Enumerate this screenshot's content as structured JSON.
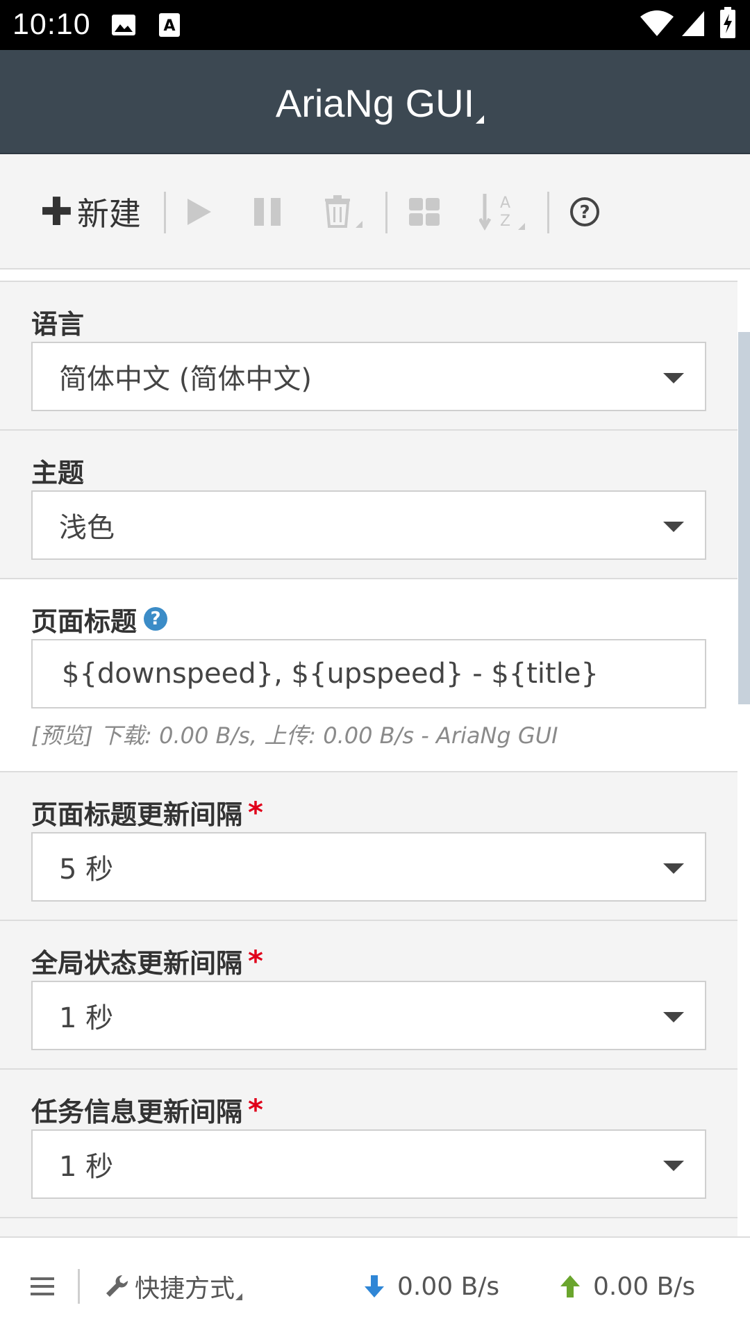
{
  "status_bar": {
    "time": "10:10"
  },
  "header": {
    "title": "AriaNg GUI"
  },
  "toolbar": {
    "new_label": "新建"
  },
  "settings": [
    {
      "label": "语言",
      "value": "简体中文 (简体中文)"
    },
    {
      "label": "主题",
      "value": "浅色"
    },
    {
      "label": "页面标题",
      "input_value": "${downspeed}, ${upspeed} - ${title}",
      "preview": "[预览] 下载: 0.00 B/s, 上传: 0.00 B/s - AriaNg GUI"
    },
    {
      "label": "页面标题更新间隔",
      "required": "*",
      "value": "5 秒"
    },
    {
      "label": "全局状态更新间隔",
      "required": "*",
      "value": "1 秒"
    },
    {
      "label": "任务信息更新间隔",
      "required": "*",
      "value": "1 秒"
    }
  ],
  "footer": {
    "shortcut_label": "快捷方式",
    "download_speed": "0.00 B/s",
    "upload_speed": "0.00 B/s"
  },
  "colors": {
    "header_bg": "#3c4852",
    "download_arrow": "#2f86d6",
    "upload_arrow": "#6aa52d",
    "required_star": "#e0001a"
  }
}
